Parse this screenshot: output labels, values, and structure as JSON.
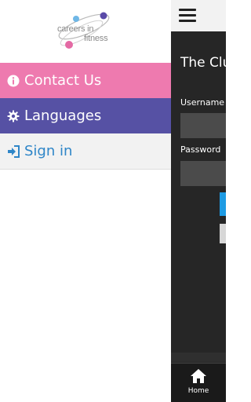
{
  "logo": {
    "line1": "careers in",
    "line2": "fitness"
  },
  "drawer": {
    "items": [
      {
        "label": "Contact Us",
        "icon": "info-circle-icon",
        "color": "#ee7aaf"
      },
      {
        "label": "Languages",
        "icon": "gear-icon",
        "color": "#5651a4"
      },
      {
        "label": "Sign in",
        "icon": "sign-in-icon",
        "color": "#2f86c8"
      }
    ]
  },
  "main": {
    "title": "The Clu",
    "username_label": "Username",
    "password_label": "Password"
  },
  "bottom_nav": {
    "home_label": "Home"
  }
}
